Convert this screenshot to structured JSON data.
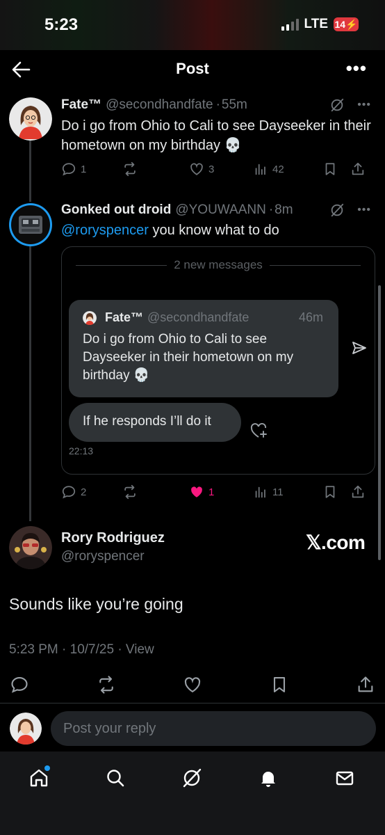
{
  "status_bar": {
    "time": "5:23",
    "network": "LTE",
    "battery": "14"
  },
  "header": {
    "title": "Post"
  },
  "posts": [
    {
      "name": "Fate™",
      "handle": "@secondhandfate",
      "time": "55m",
      "text": "Do i go from Ohio to Cali to see Dayseeker in their hometown on my birthday 💀",
      "replies": "1",
      "reposts": "",
      "likes": "3",
      "views": "42"
    },
    {
      "name": "Gonked out droid",
      "handle": "@YOUWAANN",
      "time": "8m",
      "mention": "@roryspencer",
      "text": " you know what to do",
      "replies": "2",
      "reposts": "",
      "likes": "1",
      "views": "11"
    }
  ],
  "dm_card": {
    "divider_text": "2 new messages",
    "quoted": {
      "name": "Fate™",
      "handle": "@secondhandfate",
      "time": "46m",
      "text": "Do i go from Ohio to Cali to see Dayseeker in their hometown on my birthday 💀"
    },
    "reply": "If he responds I’ll do it",
    "timestamp": "22:13"
  },
  "main_post": {
    "name": "Rory Rodriguez",
    "handle": "@roryspencer",
    "source_logo": "𝕏.com",
    "text": "Sounds like you’re going",
    "meta": "5:23 PM · 10/7/25 · View"
  },
  "reply_box": {
    "placeholder": "Post your reply"
  },
  "colors": {
    "accent": "#1d9bf0",
    "like": "#f91880",
    "muted": "#71767b",
    "background": "#000000"
  },
  "tab_bar": [
    "home-icon",
    "search-icon",
    "grok-icon",
    "notifications-icon",
    "messages-icon"
  ]
}
